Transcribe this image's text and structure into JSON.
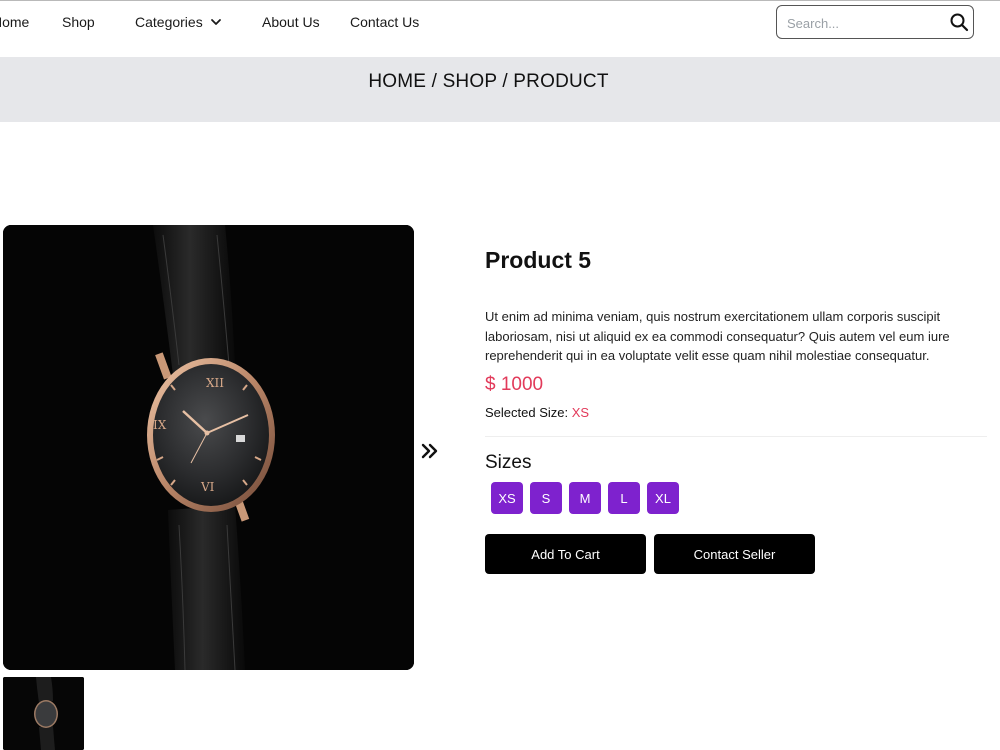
{
  "nav": {
    "links": [
      "Home",
      "Shop",
      "Categories",
      "About Us",
      "Contact Us"
    ],
    "search_placeholder": "Search..."
  },
  "breadcrumb": "HOME / SHOP / PRODUCT",
  "product": {
    "title": "Product 5",
    "description": "Ut enim ad minima veniam, quis nostrum exercitationem ullam corporis suscipit laboriosam, nisi ut aliquid ex ea commodi consequatur? Quis autem vel eum iure reprehenderit qui in ea voluptate velit esse quam nihil molestiae consequatur.",
    "price": "$ 1000",
    "selected_size_label": "Selected Size:",
    "selected_size_value": "XS",
    "sizes_title": "Sizes",
    "sizes": [
      "XS",
      "S",
      "M",
      "L",
      "XL"
    ],
    "add_to_cart": "Add To Cart",
    "contact_seller": "Contact Seller"
  },
  "colors": {
    "accent_purple": "#7e22ce",
    "price_red": "#e23a5a",
    "breadcrumb_bg": "#e6e7ea"
  },
  "icons": {
    "search": "search-icon",
    "chevron": "chevron-down-icon",
    "next": "double-chevron-right-icon"
  }
}
